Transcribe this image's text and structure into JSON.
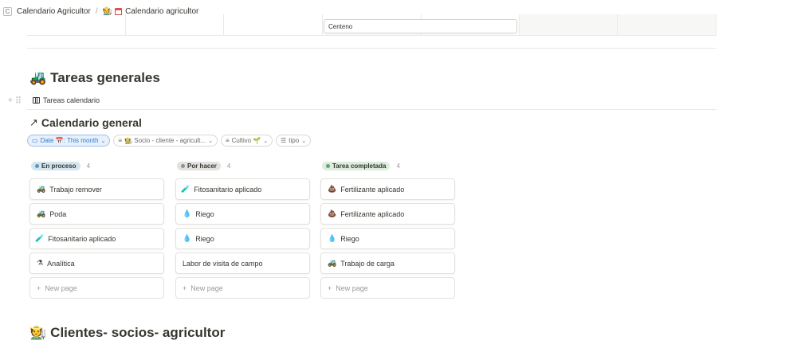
{
  "breadcrumb": {
    "workspace_icon": "C",
    "items": [
      {
        "label": "Calendario Agricultor",
        "icon": ""
      },
      {
        "label": "Calendario agricultor",
        "icon": "calendar-icon"
      }
    ],
    "separator": "/"
  },
  "previous_table": {
    "visible_input_value": "Centeno"
  },
  "sections": {
    "tareas": {
      "emoji": "🚜",
      "title": "Tareas generales"
    },
    "clientes": {
      "emoji": "🧑‍🌾",
      "title": "Clientes- socios- agricultor"
    }
  },
  "view": {
    "label": "Tareas calendario",
    "linked_title": "Calendario general",
    "linked_arrow": "↗"
  },
  "filters": [
    {
      "icon": "▭",
      "label": "Date 📅: This month",
      "active": true
    },
    {
      "icon": "≡",
      "label": "🧑‍🌾 Socio - cliente - agricult...",
      "active": false
    },
    {
      "icon": "≡",
      "label": "Cultivo 🌱",
      "active": false
    },
    {
      "icon": "☰",
      "label": "tipo",
      "active": false
    }
  ],
  "board": {
    "columns": [
      {
        "name": "En proceso",
        "count": "4",
        "color": "#d3e5ef",
        "dot": "#5b97bd",
        "cards": [
          {
            "icon": "🚜",
            "title": "Trabajo remover"
          },
          {
            "icon": "🚜",
            "title": "Poda"
          },
          {
            "icon": "🧪",
            "title": "Fitosanitario aplicado"
          },
          {
            "icon": "⚗",
            "title": "Analítica"
          }
        ],
        "new_label": "New page"
      },
      {
        "name": "Por hacer",
        "count": "4",
        "color": "#e3e2e0",
        "dot": "#91918e",
        "cards": [
          {
            "icon": "🧪",
            "title": "Fitosanitario aplicado"
          },
          {
            "icon": "💧",
            "title": "Riego"
          },
          {
            "icon": "💧",
            "title": "Riego"
          },
          {
            "icon": "",
            "title": "Labor de visita de campo"
          }
        ],
        "new_label": "New page"
      },
      {
        "name": "Tarea completada",
        "count": "4",
        "color": "#dbeddb",
        "dot": "#6c9b7d",
        "cards": [
          {
            "icon": "💩",
            "title": "Fertilizante aplicado"
          },
          {
            "icon": "💩",
            "title": "Fertilizante aplicado"
          },
          {
            "icon": "💧",
            "title": "Riego"
          },
          {
            "icon": "🚜",
            "title": "Trabajo de carga"
          }
        ],
        "new_label": "New page"
      }
    ]
  },
  "colors": {
    "accent_blue": "#2f7cd3",
    "text": "#37352f",
    "muted": "#9b9a97",
    "divider": "#e9e9e7"
  }
}
